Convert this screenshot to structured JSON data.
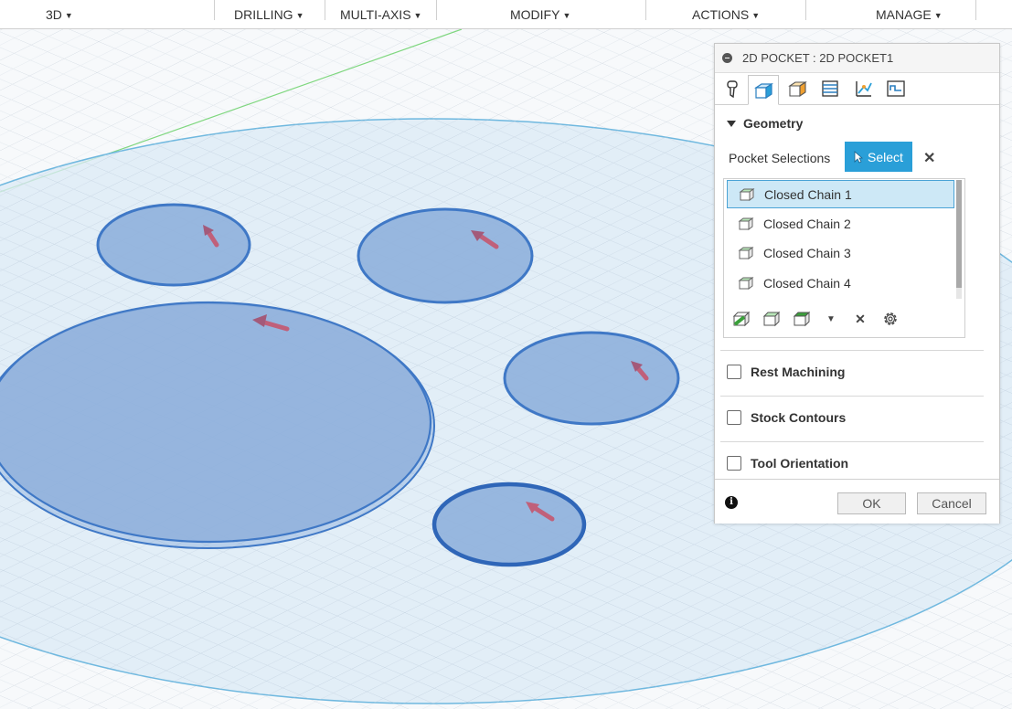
{
  "toolbar": {
    "items": [
      {
        "label": "3D"
      },
      {
        "label": "DRILLING"
      },
      {
        "label": "MULTI-AXIS"
      },
      {
        "label": "MODIFY"
      },
      {
        "label": "ACTIONS"
      },
      {
        "label": "MANAGE"
      }
    ],
    "caret_icon": "caret-down-icon"
  },
  "panel": {
    "title": "2D POCKET : 2D POCKET1",
    "tabs": [
      {
        "icon": "tool-tab-icon"
      },
      {
        "icon": "geometry-tab-icon",
        "active": true
      },
      {
        "icon": "heights-tab-icon"
      },
      {
        "icon": "passes-tab-icon"
      },
      {
        "icon": "linking-tab-icon"
      },
      {
        "icon": "post-tab-icon"
      }
    ],
    "geometry": {
      "header": "Geometry",
      "pocket_selections_label": "Pocket Selections",
      "select_label": "Select",
      "chains": [
        {
          "label": "Closed Chain 1",
          "selected": true
        },
        {
          "label": "Closed Chain 2"
        },
        {
          "label": "Closed Chain 3"
        },
        {
          "label": "Closed Chain 4"
        }
      ]
    },
    "options": [
      {
        "label": "Rest Machining",
        "checked": false
      },
      {
        "label": "Stock Contours",
        "checked": false
      },
      {
        "label": "Tool Orientation",
        "checked": false
      }
    ],
    "footer": {
      "ok_label": "OK",
      "cancel_label": "Cancel"
    }
  },
  "colors": {
    "accent": "#2a9fd8",
    "pocket_fill": "#8fb0dc",
    "pocket_edge": "#3f78c6",
    "stock_edge": "#6fb8df",
    "arrow": "#c0607a"
  }
}
